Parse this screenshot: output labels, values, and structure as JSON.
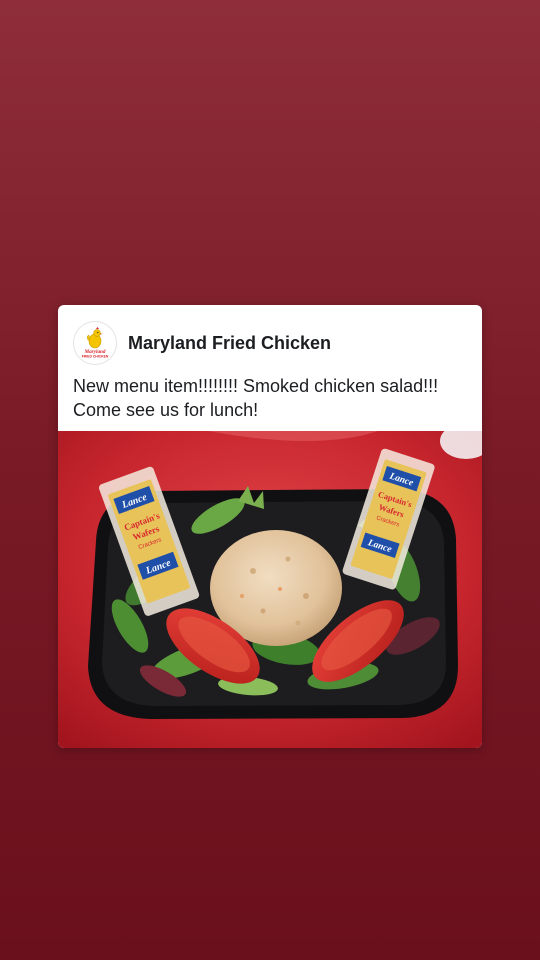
{
  "post": {
    "page_name": "Maryland Fried Chicken",
    "avatar": {
      "icon": "chicken-logo-icon",
      "logo_text_line1": "Maryland",
      "logo_text_line2": "FRIED CHICKEN"
    },
    "text": "New menu item!!!!!!!! Smoked chicken salad!!! Come see us for lunch!",
    "photo": {
      "subject": "salad-photo",
      "cracker_brand": "Lance",
      "cracker_name_line1": "Captain's",
      "cracker_name_line2": "Wafers",
      "cracker_name_line3": "Crackers"
    }
  },
  "colors": {
    "background_top": "#8f2e3a",
    "background_bottom": "#6a0f1c",
    "card": "#ffffff",
    "text": "#1c1e21"
  }
}
